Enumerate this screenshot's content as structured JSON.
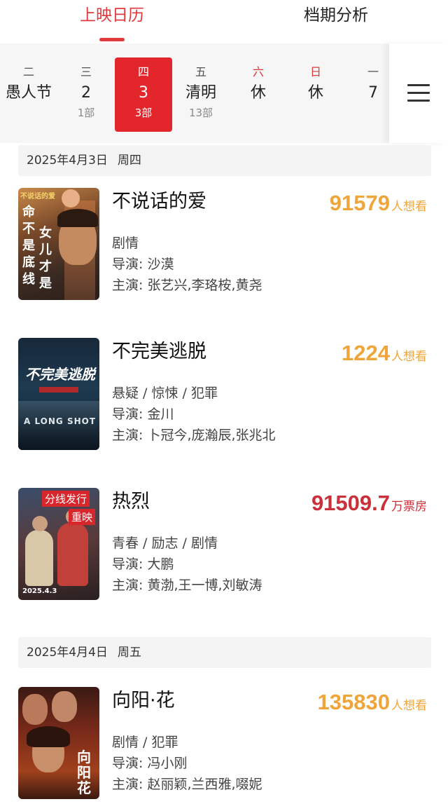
{
  "top_tabs": [
    {
      "label": "上映日历",
      "active": true
    },
    {
      "label": "档期分析",
      "active": false
    }
  ],
  "calendar": {
    "days": [
      {
        "weekday": "二",
        "date": "愚人节",
        "count": ""
      },
      {
        "weekday": "三",
        "date": "2",
        "count": "1部"
      },
      {
        "weekday": "四",
        "date": "3",
        "count": "3部",
        "selected": true
      },
      {
        "weekday": "五",
        "date": "清明",
        "count": "13部"
      },
      {
        "weekday": "六",
        "date": "休",
        "count": ""
      },
      {
        "weekday": "日",
        "date": "休",
        "count": ""
      },
      {
        "weekday": "一",
        "date": "7",
        "count": ""
      }
    ],
    "menu_icon": "menu-icon"
  },
  "sections": [
    {
      "date": "2025年4月3日",
      "weekday": "周四",
      "movies": [
        {
          "title": "不说话的爱",
          "metric_value": "91579",
          "metric_unit": "人想看",
          "metric_color": "#f0a53a",
          "genres": "剧情",
          "director": "导演: 沙漠",
          "cast": "主演: 张艺兴,李珞桉,黄尧",
          "poster_text": [
            "不说话的爱",
            "命",
            "不",
            "是",
            "底",
            "线",
            "女",
            "儿",
            "才",
            "是"
          ]
        },
        {
          "title": "不完美逃脱",
          "metric_value": "1224",
          "metric_unit": "人想看",
          "metric_color": "#f0a53a",
          "genres": "悬疑 / 惊悚 / 犯罪",
          "director": "导演: 金川",
          "cast": "主演: 卜冠今,庞瀚辰,张兆北",
          "poster_text": [
            "不完美逃脱",
            "A LONG SHOT"
          ]
        },
        {
          "title": "热烈",
          "metric_value": "91509.7",
          "metric_unit": "万票房",
          "metric_color": "#c9303a",
          "genres": "青春 / 励志 / 剧情",
          "director": "导演: 大鹏",
          "cast": "主演: 黄渤,王一博,刘敏涛",
          "poster_text": [
            "分线发行",
            "重映",
            "2025.4.3"
          ]
        }
      ]
    },
    {
      "date": "2025年4月4日",
      "weekday": "周五",
      "movies": [
        {
          "title": "向阳·花",
          "metric_value": "135830",
          "metric_unit": "人想看",
          "metric_color": "#f0a53a",
          "genres": "剧情 / 犯罪",
          "director": "导演: 冯小刚",
          "cast": "主演: 赵丽颖,兰西雅,啜妮",
          "poster_text": [
            "向",
            "阳",
            "花"
          ]
        }
      ]
    }
  ]
}
